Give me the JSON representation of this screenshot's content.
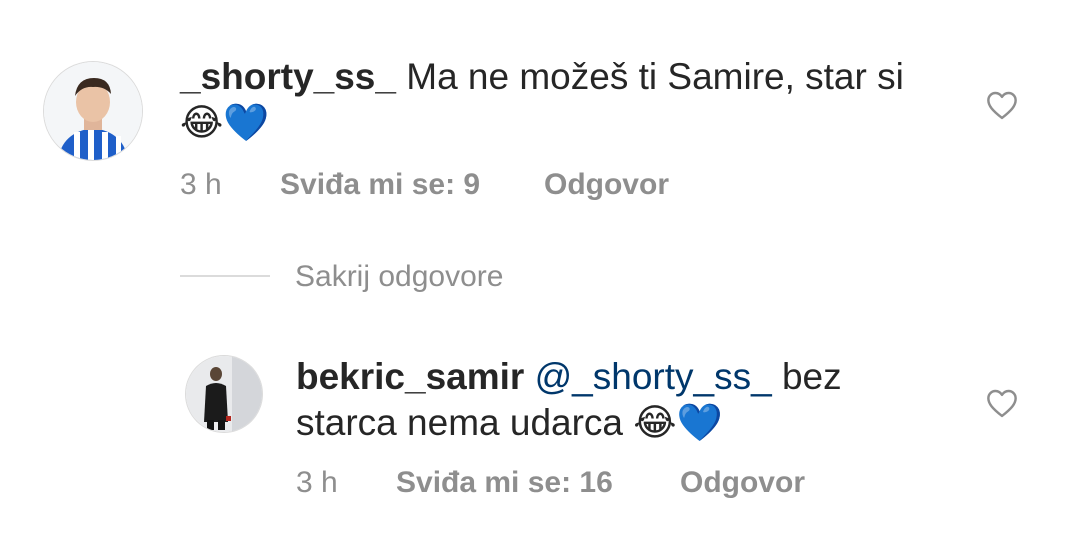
{
  "comments": [
    {
      "username": "_shorty_ss_",
      "text": "Ma ne možeš ti Samire, star si",
      "emoji": "😂💙",
      "time": "3 h",
      "likes": "Sviđa mi se: 9",
      "reply": "Odgovor"
    }
  ],
  "thread": {
    "hide_replies": "Sakrij odgovore"
  },
  "replies": [
    {
      "username": "bekric_samir",
      "mention": "@_shorty_ss_",
      "text_line1": "bez",
      "text_line2": "starca nema udarca",
      "emoji": "😂💙",
      "time": "3 h",
      "likes": "Sviđa mi se: 16",
      "reply": "Odgovor"
    }
  ],
  "colors": {
    "text": "#262626",
    "muted": "#8e8e8e",
    "mention": "#00376b",
    "heart": "#8e8e8e"
  },
  "icons": [
    "avatar",
    "heart-outline-icon"
  ]
}
